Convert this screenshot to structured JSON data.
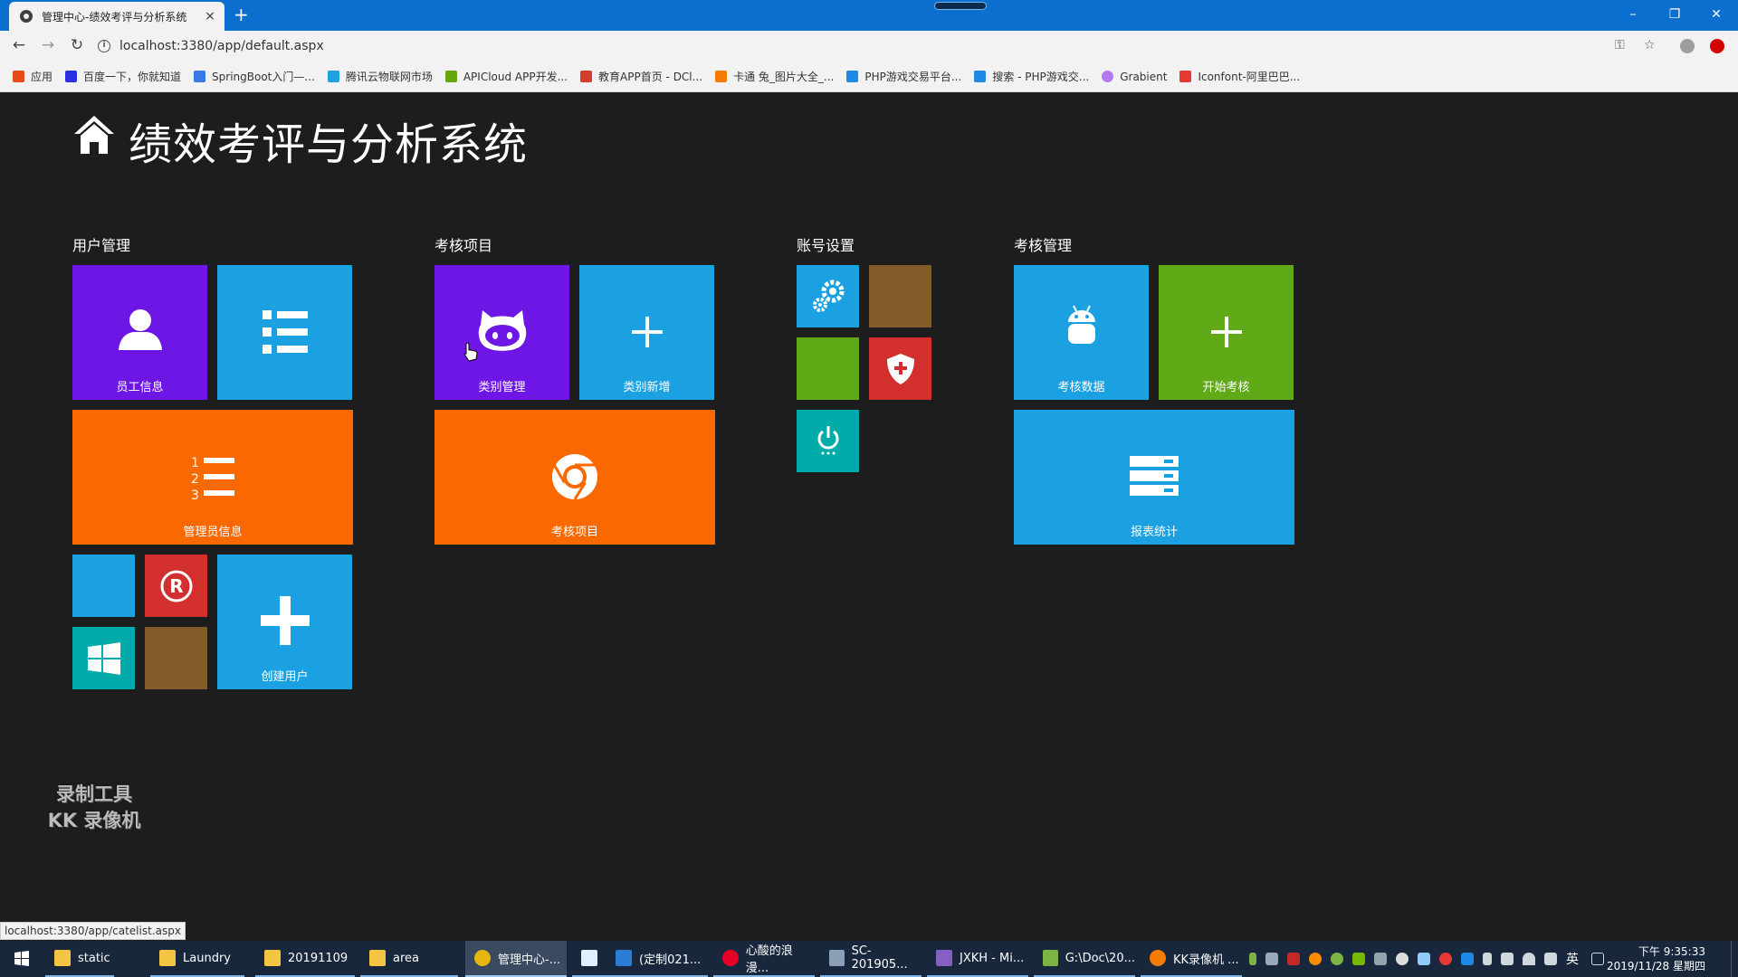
{
  "browser": {
    "tab_title": "管理中心-绩效考评与分析系统",
    "tab_close": "×",
    "new_tab": "+",
    "url": "localhost:3380/app/default.aspx",
    "window_controls": {
      "minimize": "–",
      "restore": "❐",
      "close": "✕"
    },
    "bookmarks": [
      {
        "label": "应用",
        "icon": "apps-grid-icon",
        "color": "#e64a19"
      },
      {
        "label": "百度一下，你就知道",
        "icon": "baidu-paw-icon",
        "color": "#2932e1"
      },
      {
        "label": "SpringBoot入门—...",
        "icon": "springboot-icon",
        "color": "#3b78e7"
      },
      {
        "label": "腾讯云物联网市场",
        "icon": "tencent-cloud-icon",
        "color": "#1fa3e0"
      },
      {
        "label": "APICloud APP开发...",
        "icon": "apicloud-icon",
        "color": "#64a70b"
      },
      {
        "label": "教育APP首页 - DCl...",
        "icon": "dcloud-icon",
        "color": "#d43c2c"
      },
      {
        "label": "卡通 兔_图片大全_...",
        "icon": "image-icon",
        "color": "#f57c00"
      },
      {
        "label": "PHP游戏交易平台...",
        "icon": "php-game-icon",
        "color": "#1e88e5"
      },
      {
        "label": "搜索 - PHP游戏交...",
        "icon": "search-php-icon",
        "color": "#1e88e5"
      },
      {
        "label": "Grabient",
        "icon": "grabient-icon",
        "color": "#b57bee"
      },
      {
        "label": "Iconfont-阿里巴巴...",
        "icon": "iconfont-icon",
        "color": "#e53935"
      }
    ],
    "status_url": "localhost:3380/app/catelist.aspx"
  },
  "page": {
    "app_title": "绩效考评与分析系统",
    "groups": [
      {
        "label": "用户管理"
      },
      {
        "label": "考核项目"
      },
      {
        "label": "账号设置"
      },
      {
        "label": "考核管理"
      }
    ],
    "tiles": {
      "employee_info": "员工信息",
      "admin_info": "管理员信息",
      "create_user": "创建用户",
      "category_manage": "类别管理",
      "category_add": "类别新增",
      "assessment_items": "考核项目",
      "assessment_data": "考核数据",
      "start_assessment": "开始考核",
      "report_stats": "报表统计"
    },
    "watermark": {
      "line1": "录制工具",
      "line2": "KK 录像机"
    }
  },
  "taskbar": {
    "items": [
      {
        "label": "static",
        "icon": "folder-icon"
      },
      {
        "label": "Laundry",
        "icon": "folder-icon"
      },
      {
        "label": "20191109",
        "icon": "folder-icon"
      },
      {
        "label": "area",
        "icon": "folder-icon"
      },
      {
        "label": "管理中心-...",
        "icon": "chrome-icon"
      },
      {
        "label": "",
        "icon": "feather-app-icon"
      },
      {
        "label": "(定制021...",
        "icon": "word-icon"
      },
      {
        "label": "心酸的浪漫...",
        "icon": "netease-music-icon"
      },
      {
        "label": "SC-201905...",
        "icon": "tools-icon"
      },
      {
        "label": "JXKH - Mi...",
        "icon": "visual-studio-icon"
      },
      {
        "label": "G:\\Doc\\20...",
        "icon": "notepad-icon"
      },
      {
        "label": "KK录像机 ...",
        "icon": "kk-recorder-icon"
      }
    ],
    "ime": "英",
    "clock_time": "下午 9:35:33",
    "clock_date": "2019/11/28 星期四"
  }
}
